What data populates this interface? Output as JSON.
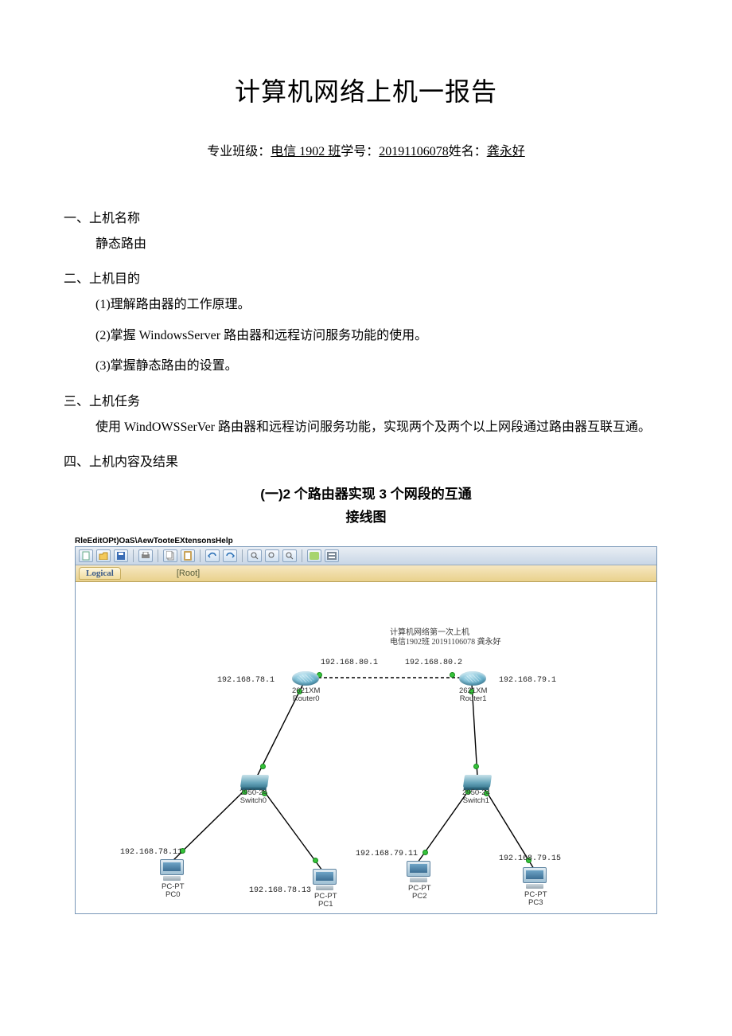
{
  "doc": {
    "title": "计算机网络上机一报告",
    "byline_major_label": "专业班级：",
    "byline_major": "电信 1902 班",
    "byline_sid_label": "学号：",
    "byline_sid": "20191106078",
    "byline_name_label": "姓名：",
    "byline_name": "龚永好",
    "s1_head": "一、上机名称",
    "s1_body": "静态路由",
    "s2_head": "二、上机目的",
    "s2_1": "(1)理解路由器的工作原理。",
    "s2_2": "(2)掌握 WindowsServer 路由器和远程访问服务功能的使用。",
    "s2_3": "(3)掌握静态路由的设置。",
    "s3_head": "三、上机任务",
    "s3_body": "使用 WindOWSSerVer 路由器和远程访问服务功能，实现两个及两个以上网段通过路由器互联互通。",
    "s4_head": "四、上机内容及结果",
    "sub1": "(一)2 个路由器实现 3 个网段的互通",
    "sub2": "接线图",
    "menubar": "RleEditOPt)OaS\\AewTooteEXtensonsHelp"
  },
  "app": {
    "logical": "Logical",
    "root": "[Root]",
    "note_line1": "计算机网络第一次上机",
    "note_line2": "电信1902班 20191106078 龚永好",
    "router0": {
      "model": "2621XM",
      "name": "Router0",
      "left_ip": "192.168.78.1",
      "right_ip": "192.168.80.1"
    },
    "router1": {
      "model": "2621XM",
      "name": "Router1",
      "left_ip": "192.168.80.2",
      "right_ip": "192.168.79.1"
    },
    "switch0": {
      "model": "2950-24",
      "name": "Switch0"
    },
    "switch1": {
      "model": "2950-24",
      "name": "Switch1"
    },
    "pc0": {
      "model": "PC-PT",
      "name": "PC0",
      "ip": "192.168.78.11"
    },
    "pc1": {
      "model": "PC-PT",
      "name": "PC1",
      "ip": "192.168.78.13"
    },
    "pc2": {
      "model": "PC-PT",
      "name": "PC2",
      "ip": "192.168.79.11"
    },
    "pc3": {
      "model": "PC-PT",
      "name": "PC3",
      "ip": "192.168.79.15"
    }
  }
}
